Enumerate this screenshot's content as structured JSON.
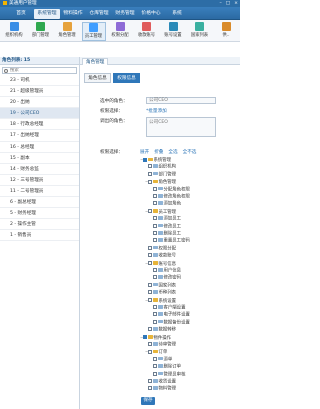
{
  "window": {
    "title": "美通用户管理"
  },
  "menubar": {
    "items": [
      "首页",
      "系统管理",
      "物料操作",
      "仓库管理",
      "财务管理",
      "价格中心",
      "系统"
    ],
    "active_index": 1
  },
  "toolbar": {
    "items": [
      {
        "label": "组织机构",
        "icon": "org-icon",
        "color": "#3a8ee6"
      },
      {
        "label": "部门管理",
        "icon": "dept-icon",
        "color": "#2fa84f"
      },
      {
        "label": "角色管理",
        "icon": "role-icon",
        "color": "#e6a23c"
      },
      {
        "label": "员工管理",
        "icon": "staff-icon",
        "color": "#409eff"
      },
      {
        "label": "权限分配",
        "icon": "permission-icon",
        "color": "#8e6bd6"
      },
      {
        "label": "收款账号",
        "icon": "account-icon",
        "color": "#e05c5c"
      },
      {
        "label": "账号设置",
        "icon": "settings-icon",
        "color": "#2b8ab8"
      },
      {
        "label": "国家列表",
        "icon": "country-icon",
        "color": "#3ab0a0"
      },
      {
        "label": "供..",
        "icon": "supplier-icon",
        "color": "#d98b2b"
      }
    ],
    "selected_index": 3
  },
  "sidebar": {
    "header": "角色列表: 15",
    "search_placeholder": "搜索",
    "roles": [
      "23 - 司机",
      "21 - 超级管理员",
      "20 - 出纳",
      "19 - 公司CEO",
      "18 - 行政总经理",
      "17 - 出纳经理",
      "16 - 总经理",
      "15 - 副本",
      "14 - 财务总监",
      "12 - 三号管理员",
      "11 - 二号管理员",
      "6 - 副总经理",
      "5 - 财务经理",
      "2 - 操作主管",
      "1 - 销售员"
    ],
    "selected_index": 3
  },
  "content": {
    "tab": "角色管理",
    "subtabs": [
      "角色信息",
      "权限信息"
    ],
    "active_subtab": 1,
    "form": {
      "role_label": "选中的角色：",
      "role_value": "公司CEO",
      "perm_label": "权限选择：",
      "perm_value": "*批量添加",
      "remark_label": "调出的角色：",
      "remark_value": "公司CEO",
      "tree_label": "权限选择："
    },
    "tree_ops": [
      "展开",
      "折叠",
      "全选",
      "全不选"
    ],
    "tree": [
      {
        "level": 0,
        "label": "系统管理",
        "type": "folder",
        "checked": true,
        "toggle": "−"
      },
      {
        "level": 1,
        "label": "组织机构",
        "type": "page",
        "checked": false,
        "toggle": ""
      },
      {
        "level": 1,
        "label": "部门管理",
        "type": "page",
        "checked": false,
        "toggle": ""
      },
      {
        "level": 1,
        "label": "角色管理",
        "type": "folder",
        "checked": false,
        "toggle": "−"
      },
      {
        "level": 2,
        "label": "分配角色权限",
        "type": "page",
        "checked": false,
        "toggle": ""
      },
      {
        "level": 2,
        "label": "修改角色权限",
        "type": "page",
        "checked": false,
        "toggle": ""
      },
      {
        "level": 2,
        "label": "添加角色",
        "type": "page",
        "checked": false,
        "toggle": ""
      },
      {
        "level": 1,
        "label": "员工管理",
        "type": "folder",
        "checked": false,
        "toggle": "−"
      },
      {
        "level": 2,
        "label": "添加员工",
        "type": "page",
        "checked": false,
        "toggle": ""
      },
      {
        "level": 2,
        "label": "修改员工",
        "type": "page",
        "checked": false,
        "toggle": ""
      },
      {
        "level": 2,
        "label": "删除员工",
        "type": "page",
        "checked": false,
        "toggle": ""
      },
      {
        "level": 2,
        "label": "重置员工密码",
        "type": "page",
        "checked": false,
        "toggle": ""
      },
      {
        "level": 1,
        "label": "权限分配",
        "type": "page",
        "checked": false,
        "toggle": ""
      },
      {
        "level": 1,
        "label": "收款账号",
        "type": "page",
        "checked": false,
        "toggle": ""
      },
      {
        "level": 1,
        "label": "账号信息",
        "type": "folder",
        "checked": false,
        "toggle": "−"
      },
      {
        "level": 2,
        "label": "用户信息",
        "type": "page",
        "checked": false,
        "toggle": ""
      },
      {
        "level": 2,
        "label": "修改密码",
        "type": "page",
        "checked": false,
        "toggle": ""
      },
      {
        "level": 1,
        "label": "国家列表",
        "type": "page",
        "checked": false,
        "toggle": ""
      },
      {
        "level": 1,
        "label": "币种列表",
        "type": "page",
        "checked": false,
        "toggle": ""
      },
      {
        "level": 1,
        "label": "系统设置",
        "type": "folder",
        "checked": false,
        "toggle": "−"
      },
      {
        "level": 2,
        "label": "客户端设置",
        "type": "page",
        "checked": false,
        "toggle": ""
      },
      {
        "level": 2,
        "label": "电子邮件设置",
        "type": "page",
        "checked": false,
        "toggle": ""
      },
      {
        "level": 2,
        "label": "数据备份设置",
        "type": "page",
        "checked": false,
        "toggle": ""
      },
      {
        "level": 1,
        "label": "数据转移",
        "type": "page",
        "checked": false,
        "toggle": ""
      },
      {
        "level": 0,
        "label": "物件操作",
        "type": "folder",
        "checked": true,
        "toggle": "−"
      },
      {
        "level": 1,
        "label": "待审管理",
        "type": "page",
        "checked": false,
        "toggle": ""
      },
      {
        "level": 1,
        "label": "订单",
        "type": "folder",
        "checked": false,
        "toggle": "−"
      },
      {
        "level": 2,
        "label": "添单",
        "type": "page",
        "checked": false,
        "toggle": ""
      },
      {
        "level": 2,
        "label": "删除订单",
        "type": "page",
        "checked": false,
        "toggle": ""
      },
      {
        "level": 2,
        "label": "管理员审核",
        "type": "page",
        "checked": false,
        "toggle": ""
      },
      {
        "level": 1,
        "label": "收货设置",
        "type": "page",
        "checked": false,
        "toggle": ""
      },
      {
        "level": 1,
        "label": "物料管理",
        "type": "page",
        "checked": false,
        "toggle": ""
      }
    ],
    "save_label": "保存"
  }
}
